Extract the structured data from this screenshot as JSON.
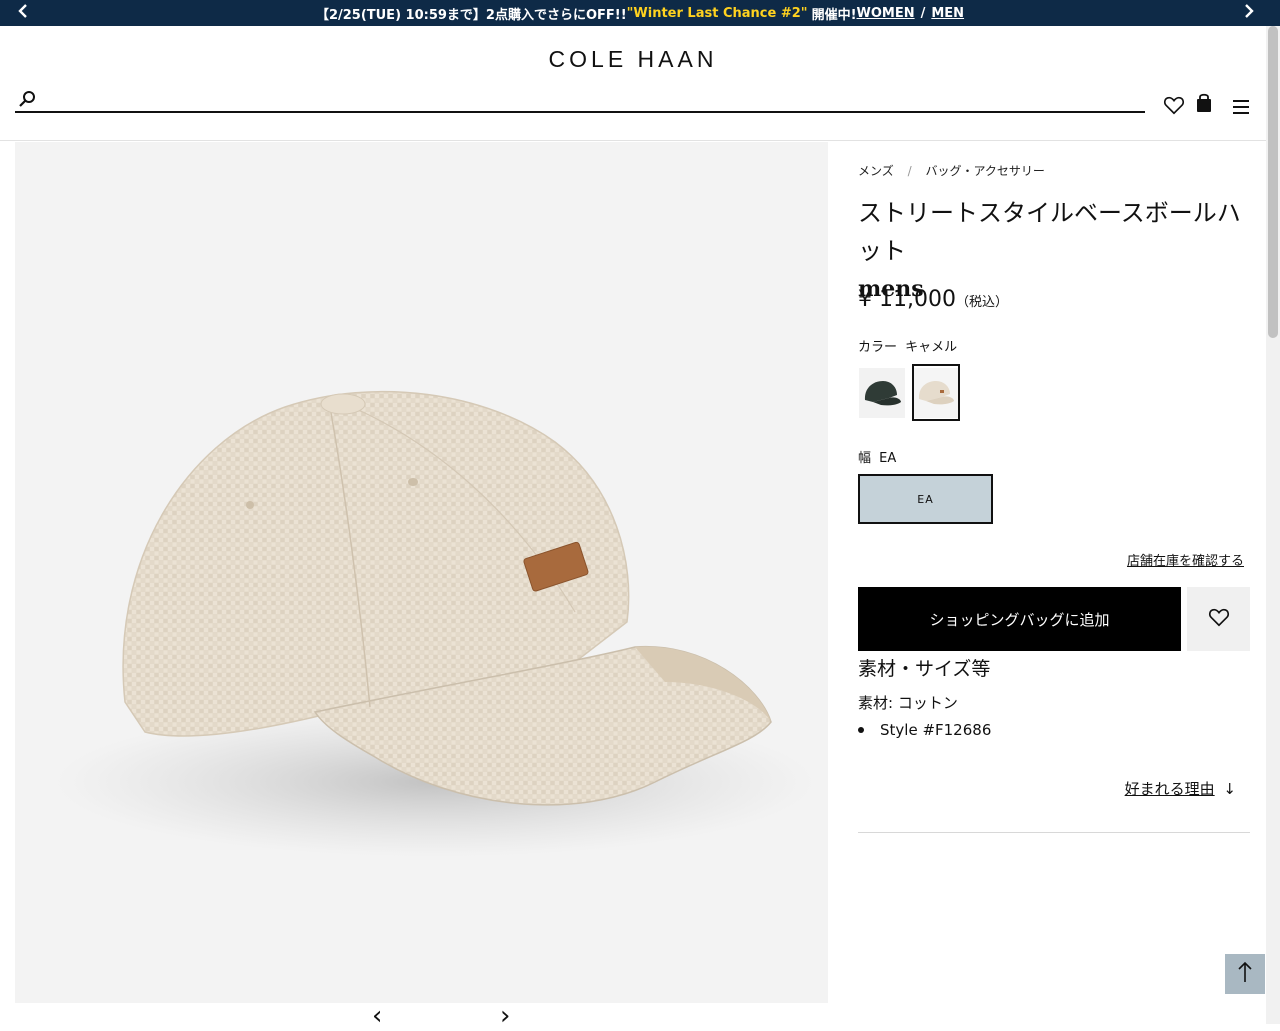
{
  "promo": {
    "text": "【2/25(TUE) 10:59まで】2点購入でさらにOFF!!",
    "highlight": "\"Winter Last Chance #2\"",
    "suffix": "開催中!",
    "link_women": "WOMEN",
    "separator": "/",
    "link_men": "MEN",
    "prev_icon": "chevron-left-icon",
    "next_icon": "chevron-right-icon"
  },
  "header": {
    "logo": "COLE HAAN",
    "search_placeholder": "",
    "icons": [
      "search-icon",
      "heart-icon",
      "shopping-bag-icon",
      "hamburger-menu-icon"
    ]
  },
  "breadcrumb": [
    "メンズ",
    "バッグ・アクセサリー"
  ],
  "product": {
    "title": "ストリートスタイルベースボールハット",
    "subtitle": "mens",
    "price": "¥ 11,000",
    "tax_note": "（税込）",
    "color_label": "カラー",
    "color_value": "キャメル",
    "swatches": [
      {
        "name": "dark-green",
        "selected": false,
        "color": "#2f3b36"
      },
      {
        "name": "camel",
        "selected": true,
        "color": "#e6dccd"
      }
    ],
    "width_label": "幅",
    "width_value": "EA",
    "width_option": "EA",
    "store_stock_link": "店舗在庫を確認する",
    "add_to_bag": "ショッピングバッグに追加",
    "materials_heading": "素材・サイズ等",
    "material": "素材: コットン",
    "style_number": "Style #F12686",
    "reasons_link": "好まれる理由",
    "reasons_arrow": "↓"
  },
  "colors": {
    "promo_bg": "#0e2a47",
    "promo_highlight": "#ffd21f",
    "image_bg": "#f3f3f3",
    "width_selected_bg": "#c5d2d9",
    "to_top_bg": "#a9b8c2"
  }
}
